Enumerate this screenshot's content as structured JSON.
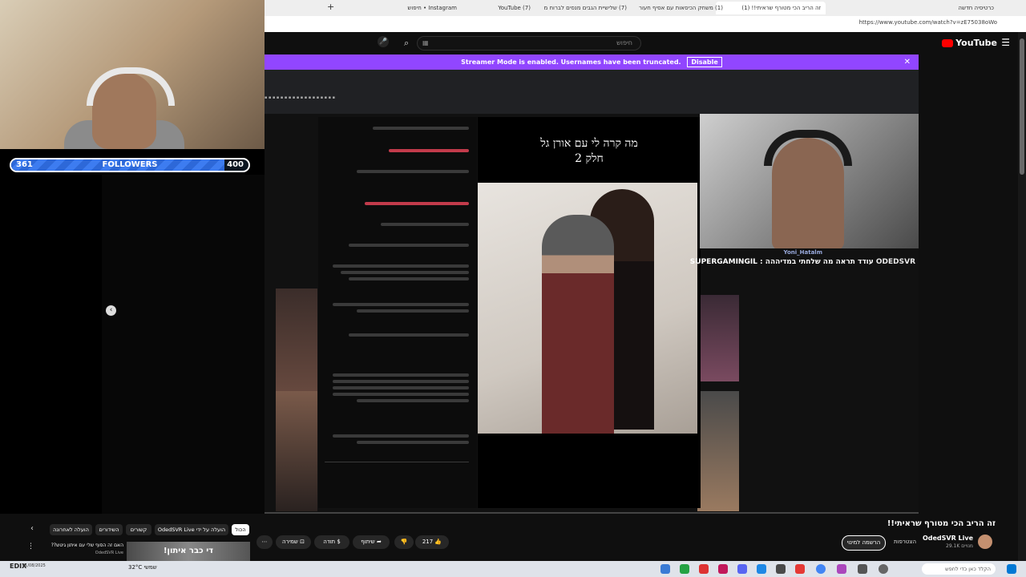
{
  "overlay": {
    "followers_current": "361",
    "followers_label": "FOLLOWERS",
    "followers_goal": "400",
    "followers_fraction": 0.9
  },
  "browser": {
    "tabs": [
      {
        "label": "זה הריב הכי מטורף שראיתי!! (1)",
        "active": true
      },
      {
        "label": "(1) משחק הכיסאות עם אסיף חעור",
        "active": false
      },
      {
        "label": "(7) שלישיית הגבים מנסים לברוח מ",
        "active": false
      },
      {
        "label": "(7) YouTube",
        "active": false
      },
      {
        "label": "Instagram • חיפוש",
        "active": false
      },
      {
        "label": "כרטיסיה חדשה",
        "active": false
      }
    ],
    "url": "https://www.youtube.com/watch?v=zE75038oWo"
  },
  "youtube": {
    "logo": "YouTube",
    "search_placeholder": "חיפוש",
    "search_value": "▦"
  },
  "stream": {
    "banner_text": "Streamer Mode is enabled. Usernames have been truncated.",
    "banner_button": "Disable",
    "reel_caption_line1": "מה קרה לי עם אורן גל",
    "reel_caption_line2": "חלק 2",
    "chat_name_top": "Yoni_Hatalm",
    "chat_name": "ODEDSVR",
    "chat_message": "עודד תראה מה שלחתי במדיההה : SUPERGAMINGIL"
  },
  "video": {
    "title": "זה הריב הכי מטורף שראיתי!!",
    "channel_name": "OdedSVR Live",
    "subscribers": "29.1K מנויים",
    "subscribe_label": "הרשמה למינוי",
    "join_label": "הצטרפות",
    "like_count": "217",
    "share_label": "שיתוף",
    "thanks_label": "תודה",
    "save_label": "שמירה"
  },
  "chips": [
    {
      "label": "הכול",
      "active": true
    },
    {
      "label": "OdedSVR Live הועלה על ידי",
      "active": false
    },
    {
      "label": "קשורים",
      "active": false
    },
    {
      "label": "השידורים",
      "active": false
    },
    {
      "label": "הועלה לאחרונה",
      "active": false
    }
  ],
  "recommended": {
    "thumb_text": "די כבר איתון!",
    "title": "האם זה הסוף שלי עם איתון גיטש??",
    "channel": "OdedSVR Live"
  },
  "taskbar": {
    "search_placeholder": "הקלד כאן כדי לחפש",
    "weather": "32°C  שמשי",
    "date": "01/08/2025",
    "overlay_text": "EDIX"
  }
}
